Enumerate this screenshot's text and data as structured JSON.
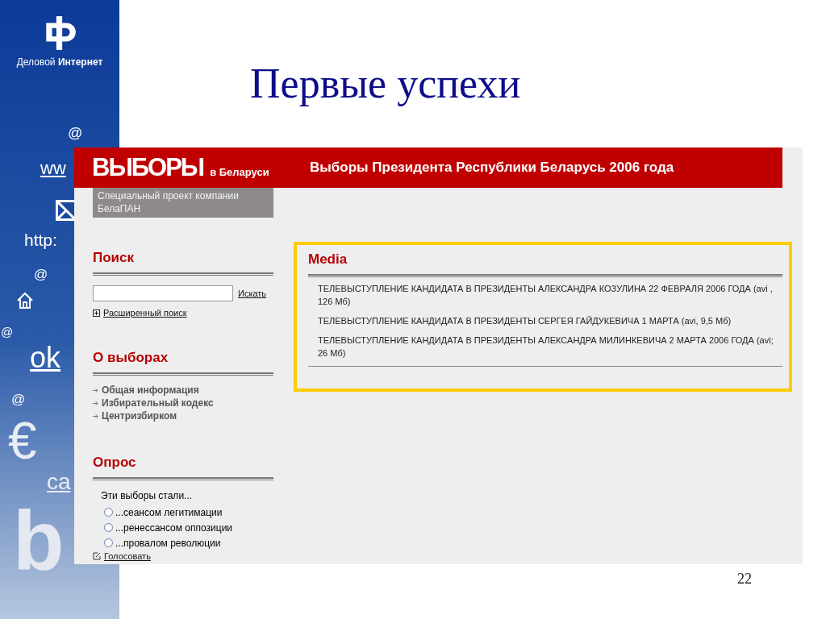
{
  "slide": {
    "logo_caption": "Деловой **Интернет**",
    "decorations": [
      {
        "kind": "text",
        "text": "@"
      },
      {
        "kind": "text",
        "text": "ww"
      },
      {
        "kind": "mail"
      },
      {
        "kind": "text",
        "text": "http:"
      },
      {
        "kind": "text",
        "text": "@"
      },
      {
        "kind": "home"
      },
      {
        "kind": "text",
        "text": "@"
      },
      {
        "kind": "text",
        "text": "ok"
      },
      {
        "kind": "text",
        "text": "@"
      },
      {
        "kind": "text",
        "text": "€"
      },
      {
        "kind": "text",
        "text": "ca"
      },
      {
        "kind": "text",
        "text": "b"
      }
    ],
    "title": "Первые успехи",
    "page_number": "22"
  },
  "site": {
    "logo": "ВЫБОРЫ",
    "logo_suffix": "в Беларуси",
    "header_title": "Выборы Президента Республики Беларусь 2006 года",
    "tagline": "Специальный проект компании БелаПАН",
    "search": {
      "heading": "Поиск",
      "button": "Искать",
      "advanced": "Расширенный поиск"
    },
    "about": {
      "heading": "О выборах",
      "links": [
        "Общая информация",
        "Избирательный кодекс",
        "Центризбирком"
      ]
    },
    "poll": {
      "heading": "Опрос",
      "question": "Эти выборы стали...",
      "options": [
        {
          "label": "...сеансом легитимации",
          "selected": false
        },
        {
          "label": "...ренессансом оппозиции",
          "selected": false
        },
        {
          "label": "...провалом революции",
          "selected": false
        }
      ],
      "vote": "Голосовать"
    },
    "media": {
      "heading": "Media",
      "items": [
        "ТЕЛЕВЫСТУПЛЕНИЕ КАНДИДАТА В ПРЕЗИДЕНТЫ АЛЕКСАНДРА КОЗУЛИНА 22 ФЕВРАЛЯ 2006 ГОДА (avi , 126 Мб)",
        "ТЕЛЕВЫСТУПЛЕНИЕ КАНДИДАТА В ПРЕЗИДЕНТЫ СЕРГЕЯ ГАЙДУКЕВИЧА 1 МАРТА (avi, 9,5 Мб)",
        "ТЕЛЕВЫСТУПЛЕНИЕ КАНДИДАТА В ПРЕЗИДЕНТЫ АЛЕКСАНДРА МИЛИНКЕВИЧА 2 МАРТА 2006 ГОДА (avi; 26 Мб)"
      ]
    }
  }
}
